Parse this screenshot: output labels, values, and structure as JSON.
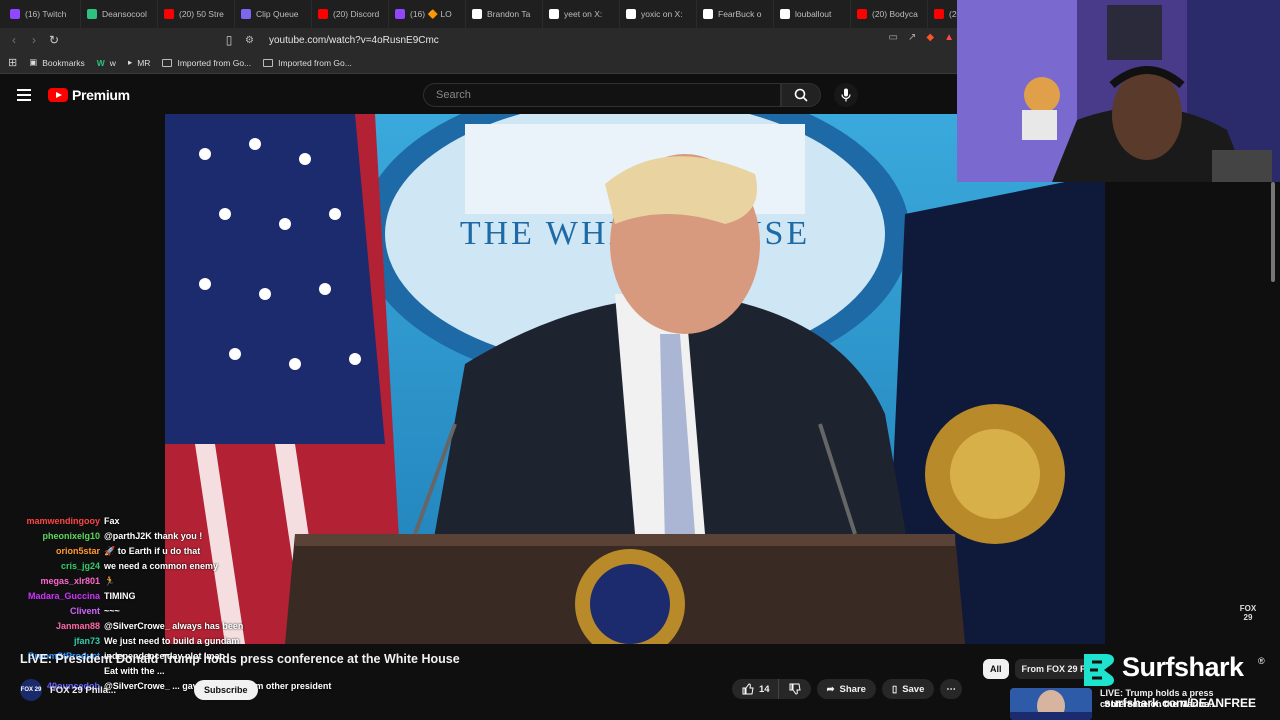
{
  "browser": {
    "tabs": [
      {
        "label": "(16) Twitch",
        "color": "#9146ff"
      },
      {
        "label": "Deansocool",
        "color": "#2ec27e"
      },
      {
        "label": "(20) 50 Stre",
        "color": "#ff0000"
      },
      {
        "label": "Clip Queue",
        "color": "#7b68ee"
      },
      {
        "label": "(20) Discord",
        "color": "#ff0000"
      },
      {
        "label": "(16) 🔶 LO",
        "color": "#9146ff"
      },
      {
        "label": "Brandon Ta",
        "color": "#ffffff"
      },
      {
        "label": "yeet on X:",
        "color": "#ffffff"
      },
      {
        "label": "yoxic on X:",
        "color": "#ffffff"
      },
      {
        "label": "FearBuck o",
        "color": "#ffffff"
      },
      {
        "label": "louballout",
        "color": "#ffffff"
      },
      {
        "label": "(20) Bodyca",
        "color": "#ff0000"
      },
      {
        "label": "(20) H",
        "color": "#ff0000"
      }
    ],
    "url": "youtube.com/watch?v=4oRusnE9Cmc",
    "bookmarks": [
      "Bookmarks",
      "w",
      "MR",
      "Imported from Go...",
      "Imported from Go..."
    ]
  },
  "youtube": {
    "logo_text": "Premium",
    "search_placeholder": "Search",
    "video_title": "LIVE: President Donald Trump holds press conference at the White House",
    "channel_avatar": "FOX 29",
    "channel_name": "FOX 29 Phila...",
    "subscribe_label": "Subscribe",
    "likes": "14",
    "share_label": "Share",
    "save_label": "Save",
    "chips": [
      "All",
      "From FOX 29 P..."
    ],
    "recommendation_title": "LIVE: Trump holds a press conference on the Marine...",
    "fox_bug": "FOX 29"
  },
  "chat": [
    {
      "name": "mamwendingooy",
      "text": "Fax",
      "color": "#ff4444"
    },
    {
      "name": "pheonixelg10",
      "text": "@parthJ2K thank you !",
      "color": "#5cd65c"
    },
    {
      "name": "orion5star",
      "text": "🚀 to Earth if u do that",
      "color": "#ff9933"
    },
    {
      "name": "cris_jg24",
      "text": "we need a common enemy",
      "color": "#33cc66"
    },
    {
      "name": "megas_xlr801",
      "text": "🏃",
      "color": "#ff66cc"
    },
    {
      "name": "Madara_Guccina",
      "text": "TIMING",
      "color": "#cc33ff"
    },
    {
      "name": "Clivent",
      "text": "~~~",
      "color": "#cc66ff"
    },
    {
      "name": "Janman88",
      "text": "@SilverCrowe_ always has been",
      "color": "#ff66aa"
    },
    {
      "name": "jfan73",
      "text": "We just need to build a gundam",
      "color": "#33ccaa"
    },
    {
      "name": "BroomStProduct",
      "text": "independence day plot lmao",
      "color": "#3399ff"
    },
    {
      "name": "",
      "text": "Eat with the ...",
      "color": "#ffffff"
    },
    {
      "name": "40ouncedob",
      "text": "@SilverCrowe_ ... gave head to soem other president",
      "color": "#6666ff"
    }
  ],
  "sponsor": {
    "brand": "Surfshark",
    "url": "surfshark.com/DEANFREE",
    "color": "#1ee3cf"
  }
}
